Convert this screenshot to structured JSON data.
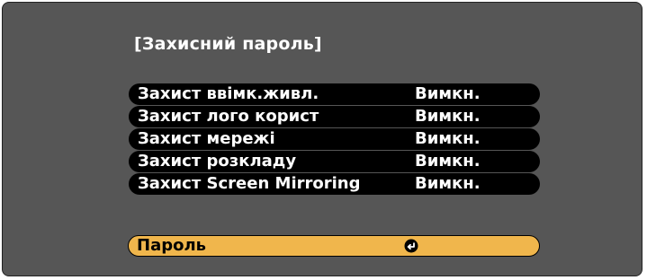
{
  "menu": {
    "title": "[Захисний пароль]",
    "items": [
      {
        "label": "Захист ввімк.живл.",
        "value": "Вимкн."
      },
      {
        "label": "Захист лого корист",
        "value": "Вимкн."
      },
      {
        "label": "Захист мережі",
        "value": "Вимкн."
      },
      {
        "label": "Захист розкладу",
        "value": "Вимкн."
      },
      {
        "label": "Захист Screen Mirroring",
        "value": "Вимкн."
      }
    ],
    "password": {
      "label": "Пароль",
      "icon": "enter-icon"
    }
  },
  "colors": {
    "panel_bg": "#565656",
    "item_bg": "#000000",
    "highlight_bg": "#f0b64c",
    "text": "#ffffff"
  }
}
